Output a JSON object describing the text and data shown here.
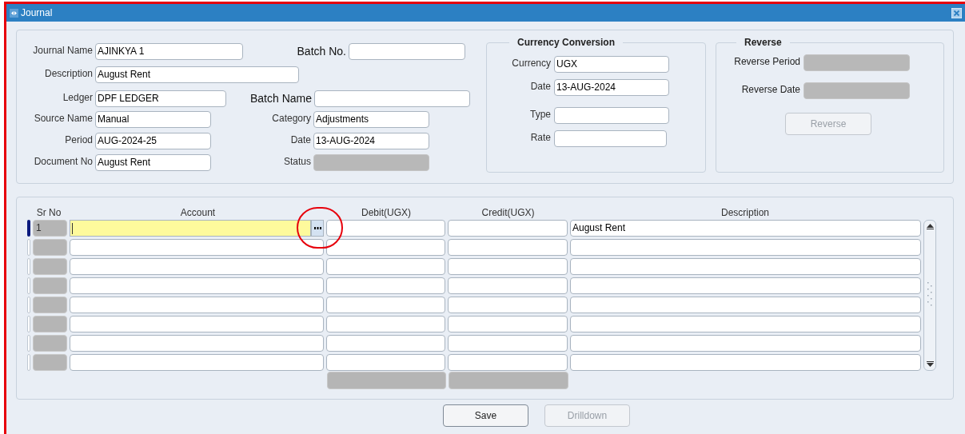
{
  "window": {
    "title": "Journal"
  },
  "journal": {
    "fields": [
      {
        "label": "Journal Name",
        "value": "AJINKYA 1",
        "disabled": false
      },
      {
        "label": "Batch No.",
        "disabled": false
      },
      {
        "label": "Description",
        "value": "August Rent",
        "disabled": false
      },
      {
        "label": "Ledger",
        "value": "DPF LEDGER",
        "disabled": false
      },
      {
        "label": "Batch Name",
        "disabled": false
      },
      {
        "label": "Source Name",
        "value": "Manual",
        "disabled": false
      },
      {
        "label": "Category",
        "value": "Adjustments",
        "disabled": false
      },
      {
        "label": "Period",
        "value": "AUG-2024-25",
        "disabled": false
      },
      {
        "label": "Date",
        "value": "13-AUG-2024",
        "disabled": false
      },
      {
        "label": "Document No",
        "value": "August Rent",
        "disabled": false
      },
      {
        "label": "Status",
        "disabled": true
      }
    ]
  },
  "currency_conversion": {
    "title": "Currency Conversion",
    "fields": [
      {
        "label": "Currency",
        "value": "UGX"
      },
      {
        "label": "Date",
        "value": "13-AUG-2024"
      },
      {
        "label": "Type"
      },
      {
        "label": "Rate"
      }
    ]
  },
  "reverse": {
    "title": "Reverse",
    "fields": [
      {
        "label": "Reverse Period",
        "disabled": true
      },
      {
        "label": "Reverse Date",
        "disabled": true
      }
    ],
    "button": {
      "label": "Reverse",
      "disabled": true
    }
  },
  "lines": {
    "columns": [
      "Sr No",
      "Account",
      "Debit(UGX)",
      "Credit(UGX)",
      "Description"
    ],
    "rows": [
      {
        "selected": true,
        "sr_no": "1",
        "description": "August Rent"
      },
      {
        "selected": false
      },
      {
        "selected": false
      },
      {
        "selected": false
      },
      {
        "selected": false
      },
      {
        "selected": false
      },
      {
        "selected": false
      },
      {
        "selected": false
      }
    ]
  },
  "buttons": [
    {
      "label": "Save",
      "disabled": false
    },
    {
      "label": "Drilldown",
      "disabled": true
    }
  ]
}
